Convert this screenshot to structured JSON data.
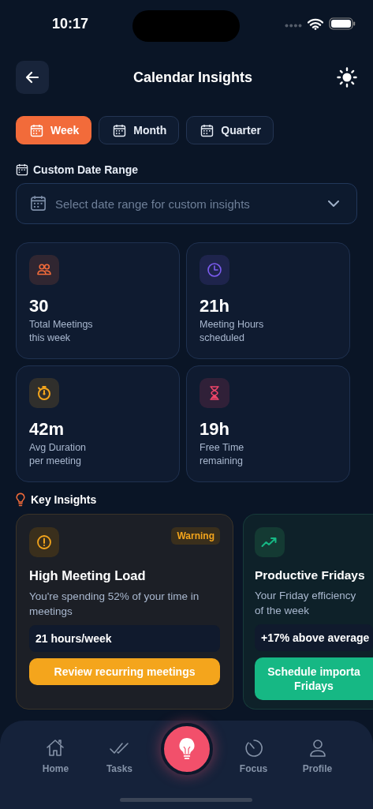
{
  "status_bar": {
    "time": "10:17"
  },
  "header": {
    "title": "Calendar Insights"
  },
  "tabs": [
    {
      "label": "Week",
      "selected": true
    },
    {
      "label": "Month",
      "selected": false
    },
    {
      "label": "Quarter",
      "selected": false
    }
  ],
  "custom_range": {
    "label": "Custom Date Range",
    "placeholder": "Select date range for custom insights"
  },
  "stats": [
    {
      "value": "30",
      "label": "Total Meetings",
      "sublabel": "this week",
      "color": "#f26b3a"
    },
    {
      "value": "21h",
      "label": "Meeting Hours",
      "sublabel": "scheduled",
      "color": "#7c5cf0"
    },
    {
      "value": "42m",
      "label": "Avg Duration",
      "sublabel": "per meeting",
      "color": "#f4a51c"
    },
    {
      "value": "19h",
      "label": "Free Time",
      "sublabel": "remaining",
      "color": "#f0466a"
    }
  ],
  "key_insights": {
    "title": "Key Insights",
    "cards": [
      {
        "kind": "warning",
        "badge": "Warning",
        "title": "High Meeting Load",
        "description": [
          "You're spending 52% of your time in",
          "meetings"
        ],
        "metric": "21 hours/week",
        "action": [
          "Review recurring meetings"
        ]
      },
      {
        "kind": "positive",
        "title": "Productive Fridays",
        "description": [
          "Your Friday efficiency",
          "of the week"
        ],
        "metric": "+17% above average",
        "action": [
          "Schedule importa",
          "Fridays"
        ]
      }
    ]
  },
  "bottom_nav": [
    {
      "label": "Home"
    },
    {
      "label": "Tasks"
    },
    {
      "label": "Focus"
    },
    {
      "label": "Profile"
    }
  ]
}
